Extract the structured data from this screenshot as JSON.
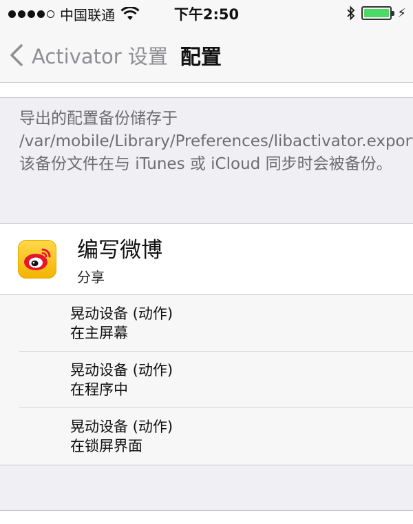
{
  "status_bar": {
    "carrier": "中国联通",
    "time": "下午2:50",
    "charging_symbol": "⚡"
  },
  "nav": {
    "back_label": "Activator 设置",
    "title": "配置"
  },
  "footer_note": "导出的配置备份储存于 /var/mobile/Library/Preferences/libactivator.exported.plist。该备份文件在与 iTunes 或 iCloud 同步时会被备份。",
  "app": {
    "name": "编写微博",
    "subtitle": "分享",
    "icon": "weibo-icon"
  },
  "assignments": [
    {
      "event": "晃动设备 (动作)",
      "mode": "在主屏幕"
    },
    {
      "event": "晃动设备 (动作)",
      "mode": "在程序中"
    },
    {
      "event": "晃动设备 (动作)",
      "mode": "在锁屏界面"
    }
  ],
  "colors": {
    "battery": "#4cd964",
    "weibo_yellow": "#f4b400",
    "weibo_red": "#e6162d"
  }
}
